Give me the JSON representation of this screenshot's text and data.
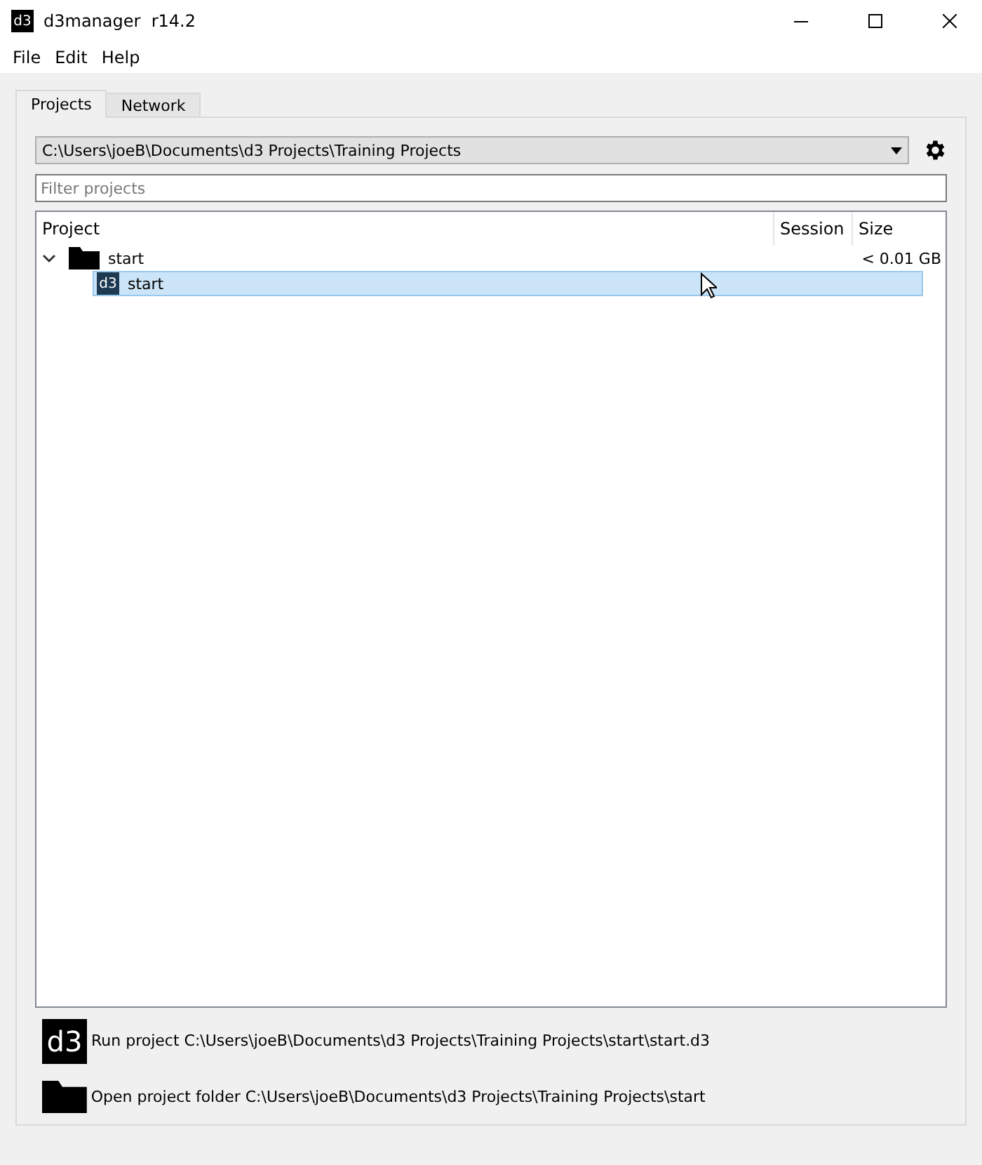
{
  "window": {
    "icon_text": "d3",
    "title": "d3manager  r14.2"
  },
  "menu": [
    "File",
    "Edit",
    "Help"
  ],
  "tabs": [
    {
      "label": "Projects",
      "selected": true
    },
    {
      "label": "Network",
      "selected": false
    }
  ],
  "path_select": {
    "value": "C:\\Users\\joeB\\Documents\\d3 Projects\\Training Projects"
  },
  "filter": {
    "placeholder": "Filter projects"
  },
  "tree": {
    "columns": [
      "Project",
      "Session",
      "Size"
    ],
    "rows": [
      {
        "kind": "folder",
        "name": "start",
        "size": "< 0.01 GB",
        "expanded": true,
        "selected": false,
        "children": [
          {
            "kind": "project",
            "icon_text": "d3",
            "name": "start",
            "selected": true
          }
        ]
      }
    ]
  },
  "actions": [
    {
      "kind": "project",
      "icon_text": "d3",
      "label": "Run project C:\\Users\\joeB\\Documents\\d3 Projects\\Training Projects\\start\\start.d3"
    },
    {
      "kind": "folder",
      "label": "Open project folder C:\\Users\\joeB\\Documents\\d3 Projects\\Training Projects\\start"
    }
  ]
}
